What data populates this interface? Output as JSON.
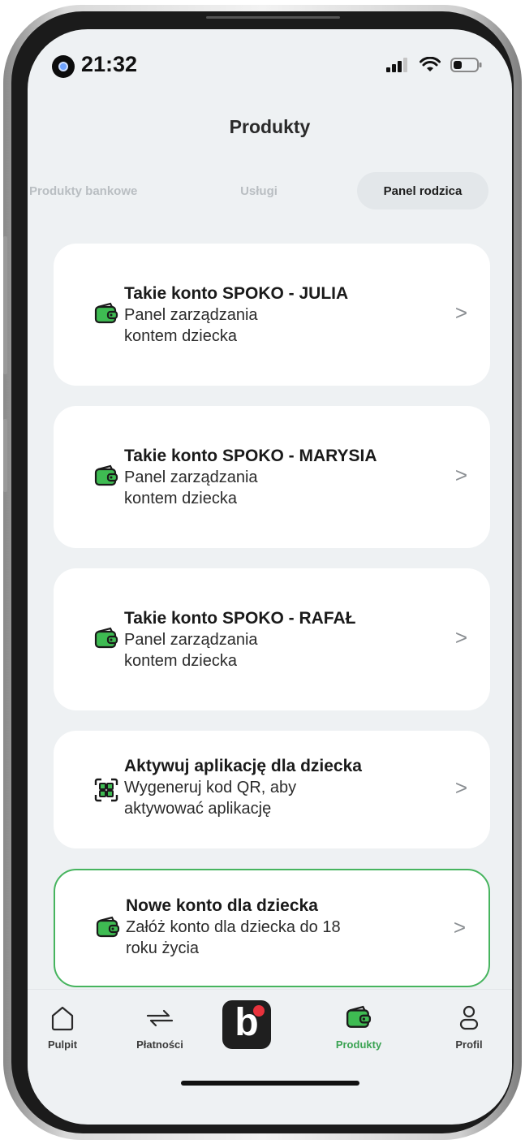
{
  "status_bar": {
    "time": "21:32"
  },
  "header": {
    "title": "Produkty"
  },
  "tabs": [
    {
      "label": "Produkty bankowe",
      "active": false
    },
    {
      "label": "Usługi",
      "active": false
    },
    {
      "label": "Panel rodzica",
      "active": true
    }
  ],
  "cards": [
    {
      "title": "Takie konto SPOKO - JULIA",
      "sub1": "Panel zarządzania",
      "sub2": "kontem dziecka",
      "icon": "wallet-icon"
    },
    {
      "title": "Takie konto SPOKO - MARYSIA",
      "sub1": "Panel zarządzania",
      "sub2": "kontem dziecka",
      "icon": "wallet-icon"
    },
    {
      "title": "Takie konto SPOKO - RAFAŁ",
      "sub1": "Panel zarządzania",
      "sub2": "kontem dziecka",
      "icon": "wallet-icon"
    },
    {
      "title": "Aktywuj aplikację dla dziecka",
      "sub1": "Wygeneruj kod QR, aby",
      "sub2": "aktywować aplikację",
      "icon": "qr-code-icon"
    },
    {
      "title": "Nowe konto dla dziecka",
      "sub1": "Załóż konto dla dziecka do 18",
      "sub2": "roku życia",
      "icon": "wallet-icon"
    }
  ],
  "chevron": ">",
  "bottom_nav": {
    "items": [
      {
        "label": "Pulpit",
        "icon": "home-icon"
      },
      {
        "label": "Płatności",
        "icon": "transfer-arrows-icon"
      },
      {
        "label": "Produkty",
        "icon": "wallet-icon",
        "active": true
      },
      {
        "label": "Profil",
        "icon": "person-icon"
      }
    ],
    "center_glyph": "b"
  },
  "colors": {
    "accent": "#3aa352",
    "highlight_border": "#46b45e",
    "background": "#eef1f3",
    "center_dot": "#e8323c"
  }
}
